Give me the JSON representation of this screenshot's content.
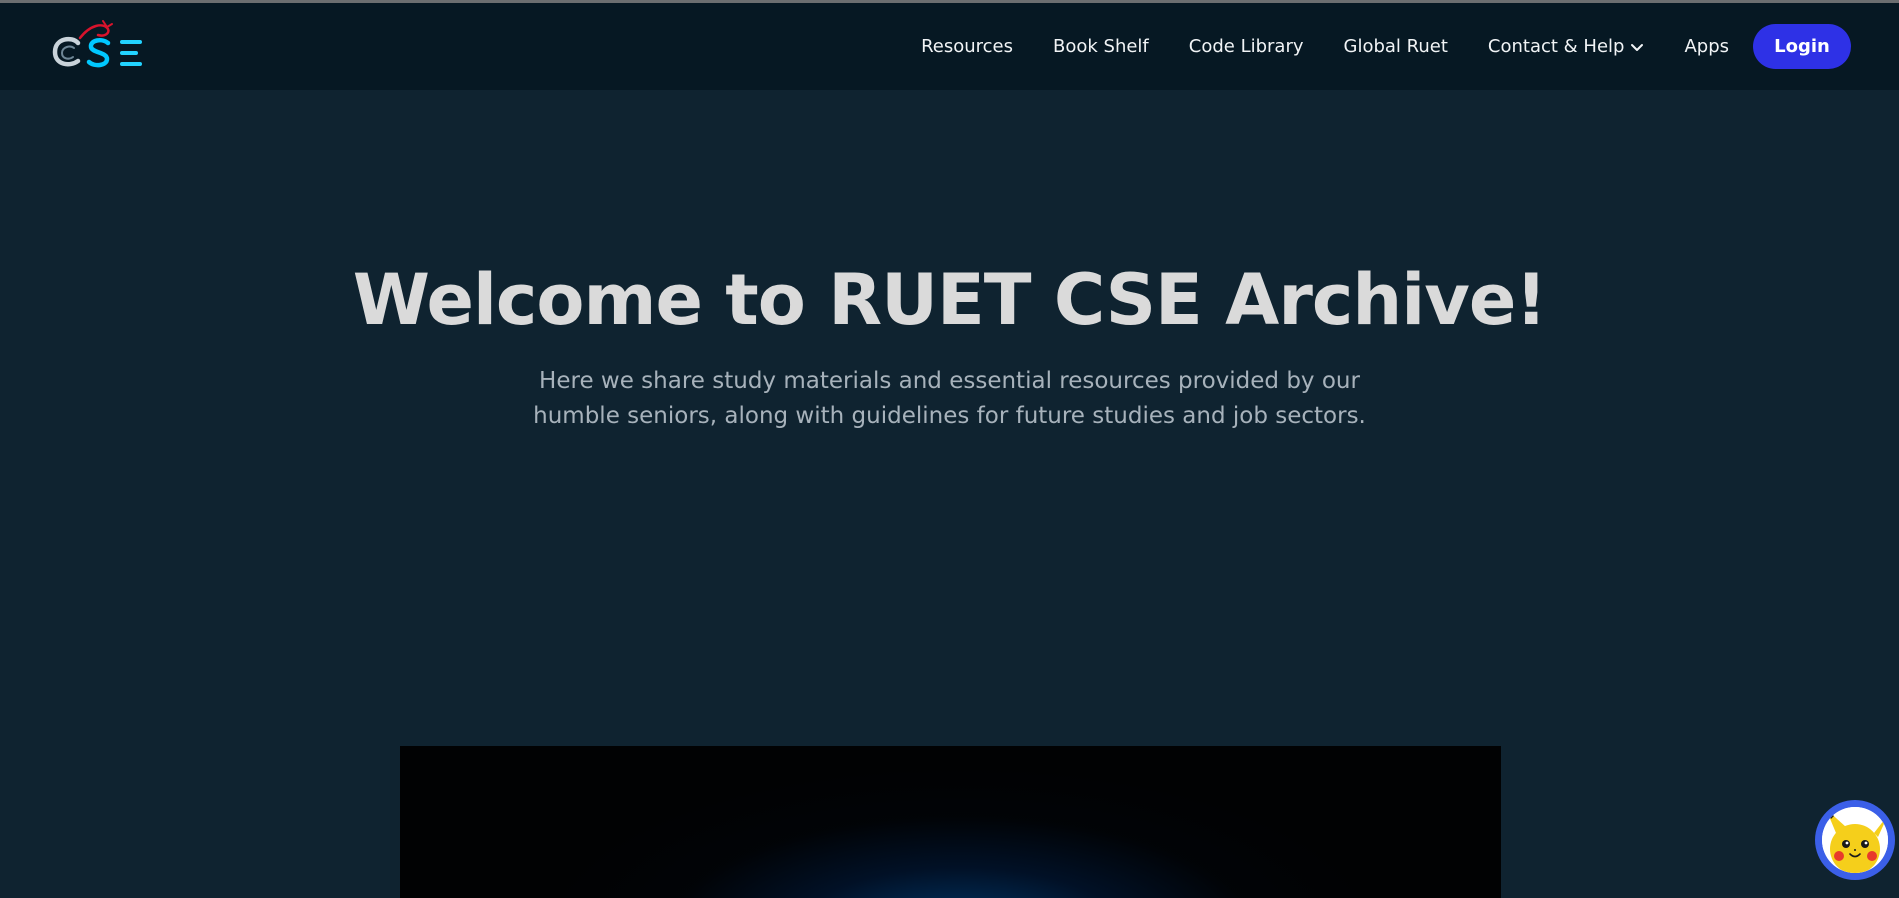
{
  "nav": {
    "logo_text": "CSE",
    "items": [
      {
        "label": "Resources"
      },
      {
        "label": "Book Shelf"
      },
      {
        "label": "Code Library"
      },
      {
        "label": "Global Ruet"
      },
      {
        "label": "Contact & Help",
        "has_dropdown": true
      },
      {
        "label": "Apps"
      }
    ],
    "login_label": "Login"
  },
  "hero": {
    "title": "Welcome to RUET CSE Archive!",
    "subtitle": "Here we share study materials and essential resources provided by our humble seniors, along with guidelines for future studies and job sectors."
  },
  "icons": {
    "logo": "cse-logo-icon",
    "dropdown": "chevron-down-icon",
    "chat": "pikachu-avatar-icon"
  },
  "colors": {
    "page_background": "#0f2330",
    "navbar_background": "#061823",
    "accent": "#2e31e6",
    "title_text": "#dadada",
    "subtitle_text": "#a7b2bb"
  }
}
